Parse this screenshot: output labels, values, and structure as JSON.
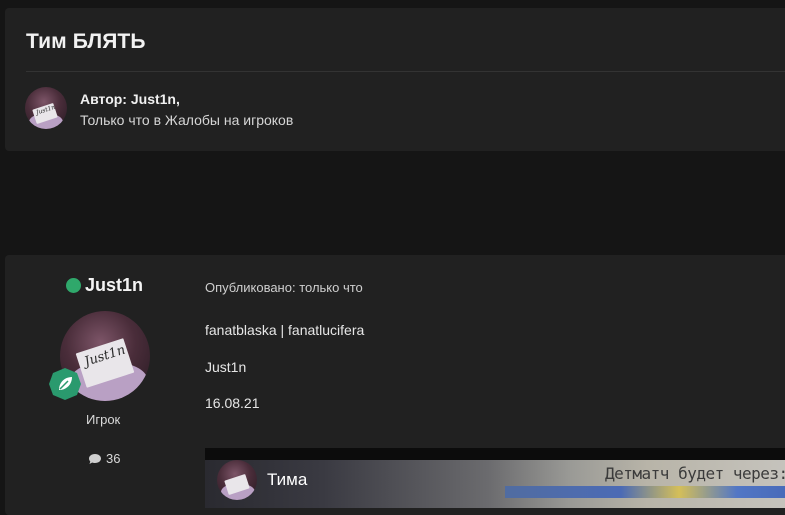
{
  "topic": {
    "title": "Тим БЛЯТЬ"
  },
  "author_block": {
    "author_label": "Автор: Just1n,",
    "meta": "Только что в Жалобы на игроков",
    "avatar_text": "Just1n"
  },
  "post": {
    "user": {
      "name": "Just1n",
      "online": true,
      "avatar_text": "Just1n",
      "rank": "Игрок",
      "post_count": "36"
    },
    "published": "Опубликовано: только что",
    "content_lines": [
      "fanatblaska | fanatlucifera",
      "Just1n",
      "16.08.21"
    ],
    "embed": {
      "title": "Тима",
      "overlay_text": "Детматч будет через:"
    }
  },
  "colors": {
    "background": "#151515",
    "card": "#212121",
    "online": "#2fa86b",
    "rank_badge": "#2a9a6e"
  }
}
